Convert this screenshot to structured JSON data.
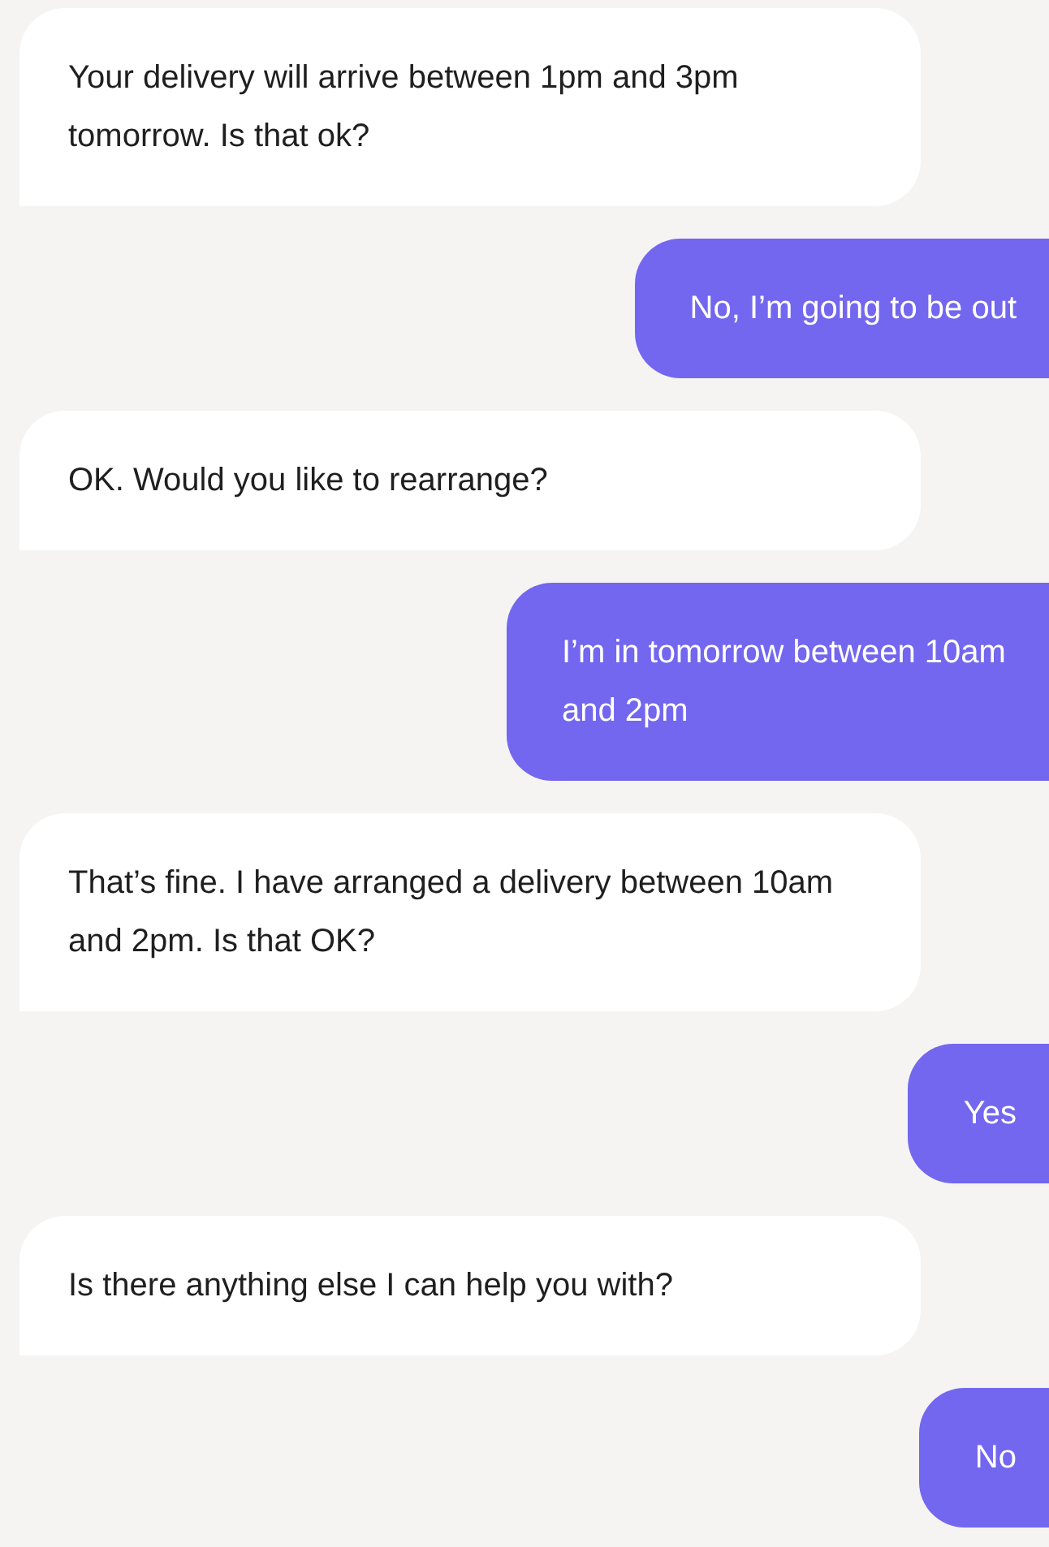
{
  "messages": [
    {
      "kind": "bot",
      "text": "Your delivery will arrive between 1pm and 3pm tomorrow. Is that ok?"
    },
    {
      "kind": "user",
      "text": "No, I’m going to be out"
    },
    {
      "kind": "bot",
      "text": "OK. Would you like to rearrange?"
    },
    {
      "kind": "user",
      "text": "I’m in tomorrow between 10am and 2pm"
    },
    {
      "kind": "bot",
      "text": "That’s fine. I have arranged a delivery between 10am and 2pm. Is that OK?"
    },
    {
      "kind": "user",
      "text": "Yes"
    },
    {
      "kind": "bot",
      "text": "Is there anything else I can help you with?"
    },
    {
      "kind": "user",
      "text": "No"
    }
  ]
}
